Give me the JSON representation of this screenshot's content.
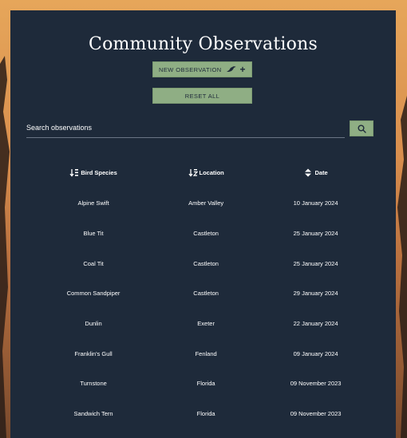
{
  "page": {
    "title": "Community Observations"
  },
  "actions": {
    "new_label": "NEW OBSERVATION",
    "new_plus": "+",
    "reset_label": "RESET ALL"
  },
  "search": {
    "placeholder": "Search observations"
  },
  "table": {
    "headers": {
      "species": "Bird Species",
      "location": "Location",
      "date": "Date"
    },
    "rows": [
      {
        "species": "Alpine Swift",
        "location": "Amber Valley",
        "date": "10 January 2024"
      },
      {
        "species": "Blue Tit",
        "location": "Castleton",
        "date": "25 January 2024"
      },
      {
        "species": "Coal Tit",
        "location": "Castleton",
        "date": "25 January 2024"
      },
      {
        "species": "Common Sandpiper",
        "location": "Castleton",
        "date": "29 January 2024"
      },
      {
        "species": "Dunlin",
        "location": "Exeter",
        "date": "22 January 2024"
      },
      {
        "species": "Franklin's Gull",
        "location": "Fenland",
        "date": "09 January 2024"
      },
      {
        "species": "Turnstone",
        "location": "Florida",
        "date": "09 November 2023"
      },
      {
        "species": "Sandwich Tern",
        "location": "Florida",
        "date": "09 November 2023"
      }
    ]
  },
  "icons": {
    "new_observation": "bird-icon",
    "search": "search-icon",
    "species_sort": "sort-ascending-icon",
    "location_sort": "sort-descending-icon",
    "date_sort": "sort-unsorted-icon"
  },
  "colors": {
    "panel": "#1e2a3a",
    "button": "#8fae84",
    "text": "#ffffff"
  }
}
